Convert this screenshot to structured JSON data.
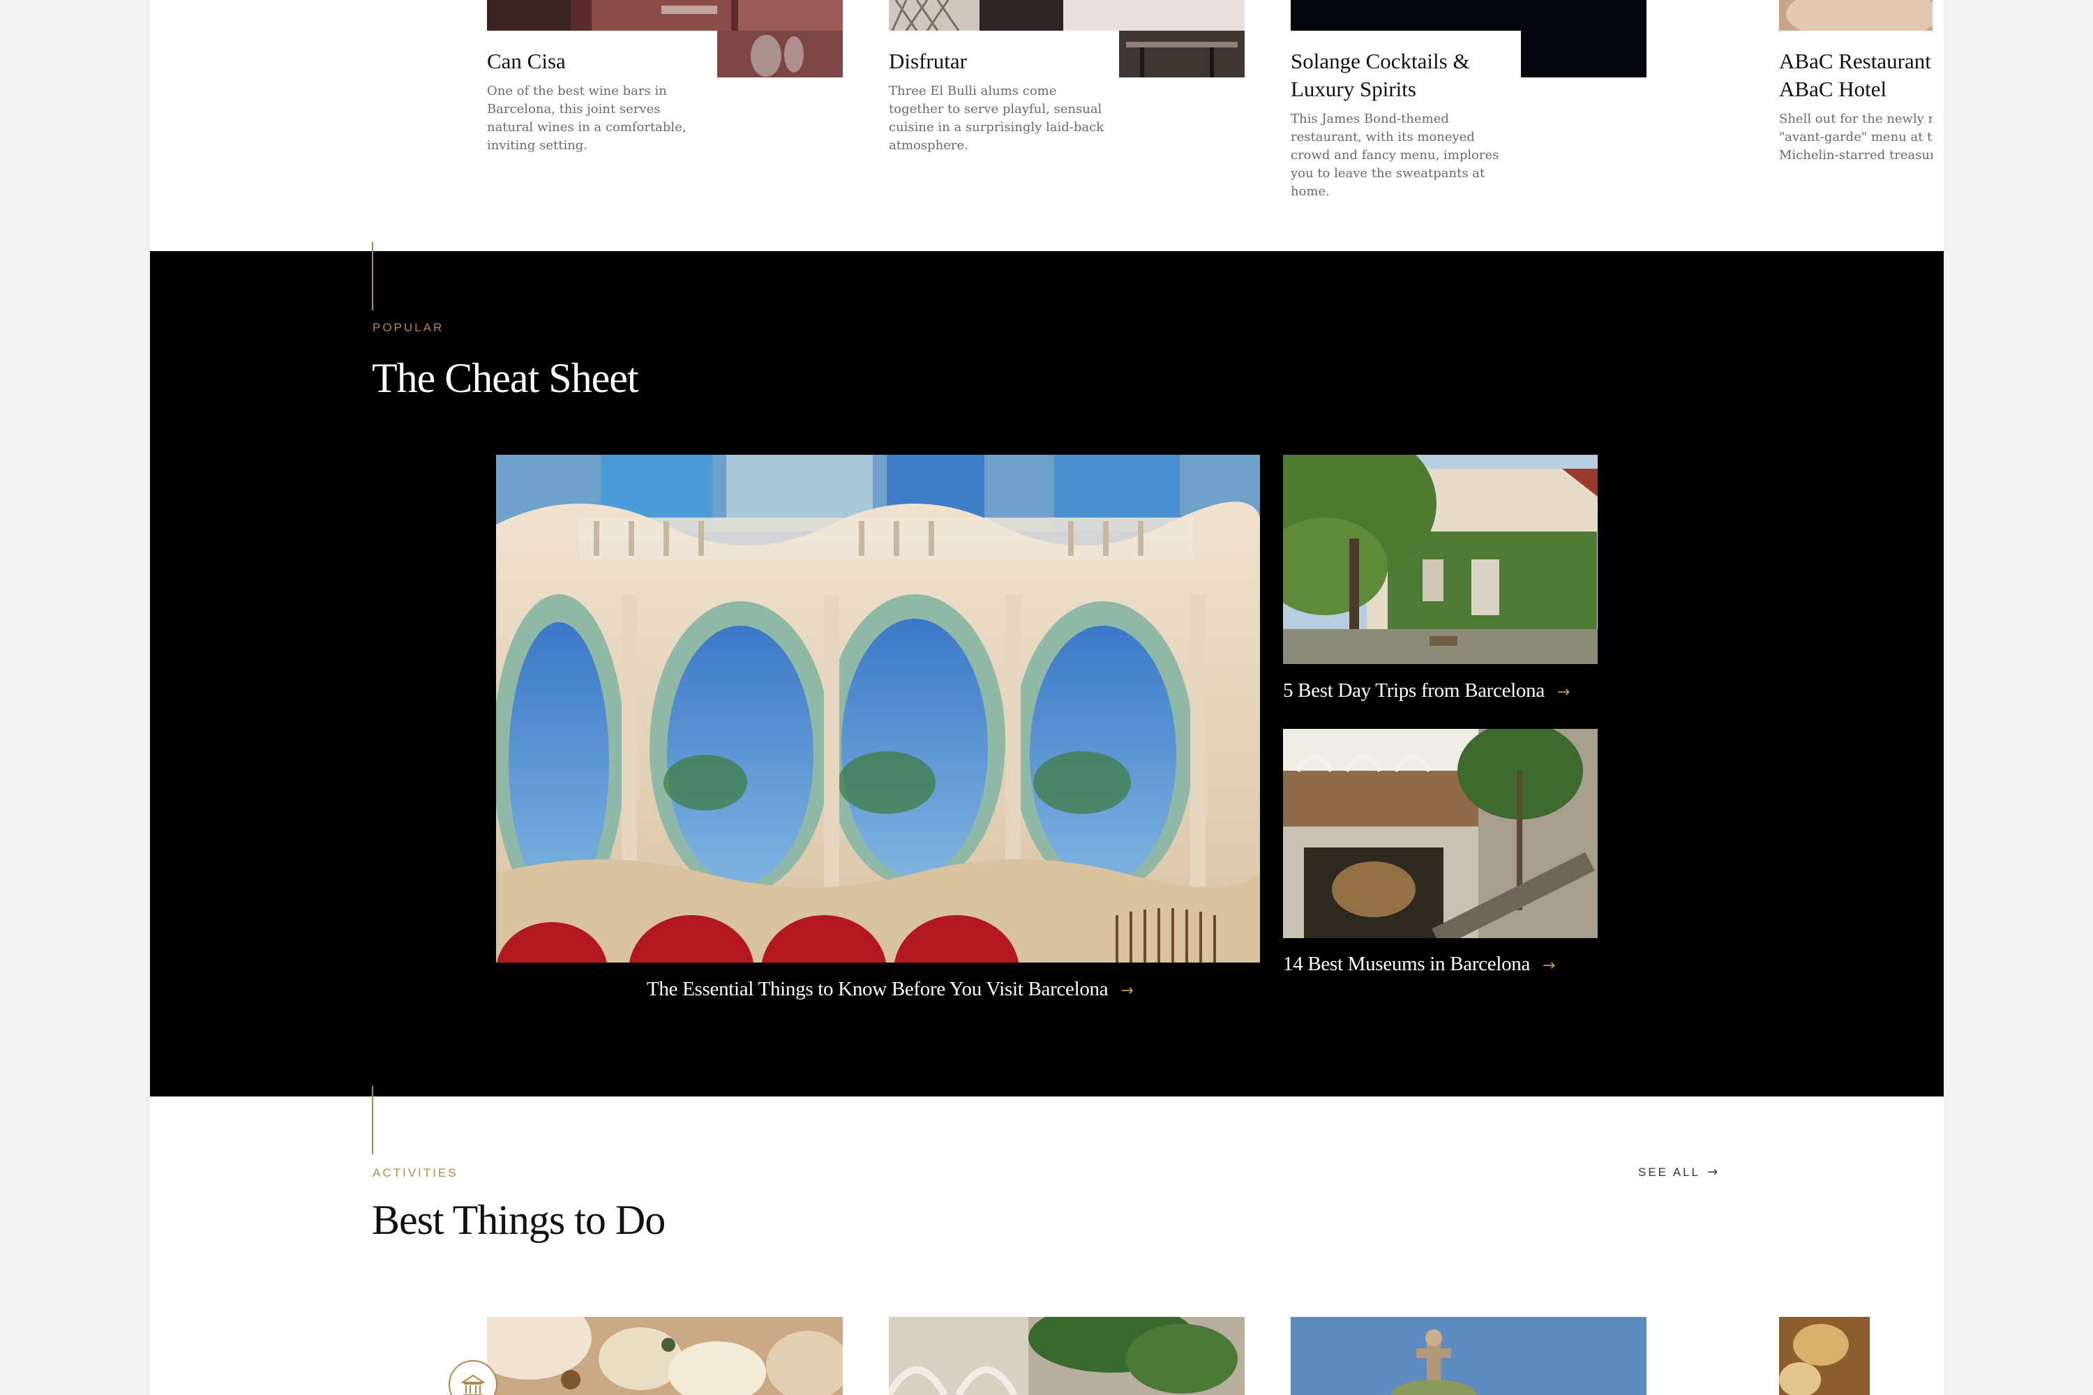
{
  "top_cards": [
    {
      "title": "Can Cisa",
      "desc": "One of the best wine bars in Barcelona, this joint serves natural wines in a comfortable, inviting setting."
    },
    {
      "title": "Disfrutar",
      "desc": "Three El Bulli alums come together to serve playful, sensual cuisine in a surprisingly laid-back atmosphere."
    },
    {
      "title": "Solange Cocktails & Luxury Spirits",
      "desc": "This James Bond-themed restaurant, with its moneyed crowd and fancy menu, implores you to leave the sweatpants at home."
    },
    {
      "title": "ABaC Restaurant & ABaC Hotel",
      "desc": "Shell out for the newly named \"avant-garde\" menu at this three-Michelin-starred treasure off the"
    }
  ],
  "cheat_sheet": {
    "eyebrow": "POPULAR",
    "title": "The Cheat Sheet",
    "main_caption": "The Essential Things to Know Before You Visit Barcelona",
    "side": [
      {
        "caption": "5 Best Day Trips from Barcelona"
      },
      {
        "caption": "14 Best Museums in Barcelona"
      }
    ]
  },
  "activities": {
    "eyebrow": "ACTIVITIES",
    "title": "Best Things to Do",
    "see_all": "SEE ALL",
    "badge_icon": "museum-icon"
  },
  "colors": {
    "accent": "#b5864a",
    "arrow": "#c89650",
    "dark_bg": "#000000"
  }
}
